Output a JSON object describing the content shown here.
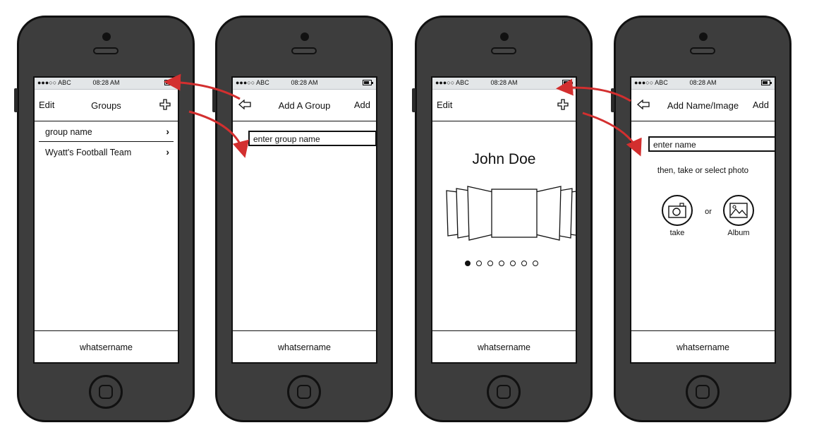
{
  "status": {
    "carrier": "●●●○○ ABC",
    "time": "08:28 AM"
  },
  "accent_color": "#d32f2f",
  "screen1": {
    "nav_left": "Edit",
    "title": "Groups",
    "right_icon": "plus-icon",
    "rows": [
      {
        "label": "group name",
        "chevron": "›"
      },
      {
        "label": "Wyatt's Football Team",
        "chevron": "›"
      }
    ],
    "footer": "whatsername"
  },
  "screen2": {
    "back_icon": "back-arrow-icon",
    "title": "Add A Group",
    "nav_right": "Add",
    "input_value": "enter group name",
    "footer": "whatsername"
  },
  "screen3": {
    "nav_left": "Edit",
    "right_icon": "plus-icon",
    "name": "John Doe",
    "carousel_icon": "coverflow-carousel",
    "page_count": 7,
    "active_page": 1,
    "footer": "whatsername"
  },
  "screen4": {
    "back_icon": "back-arrow-icon",
    "title": "Add Name/Image",
    "nav_right": "Add",
    "input_value": "enter name",
    "instruction": "then, take or select photo",
    "take_label": "take",
    "or_label": "or",
    "album_label": "Album",
    "footer": "whatsername"
  }
}
